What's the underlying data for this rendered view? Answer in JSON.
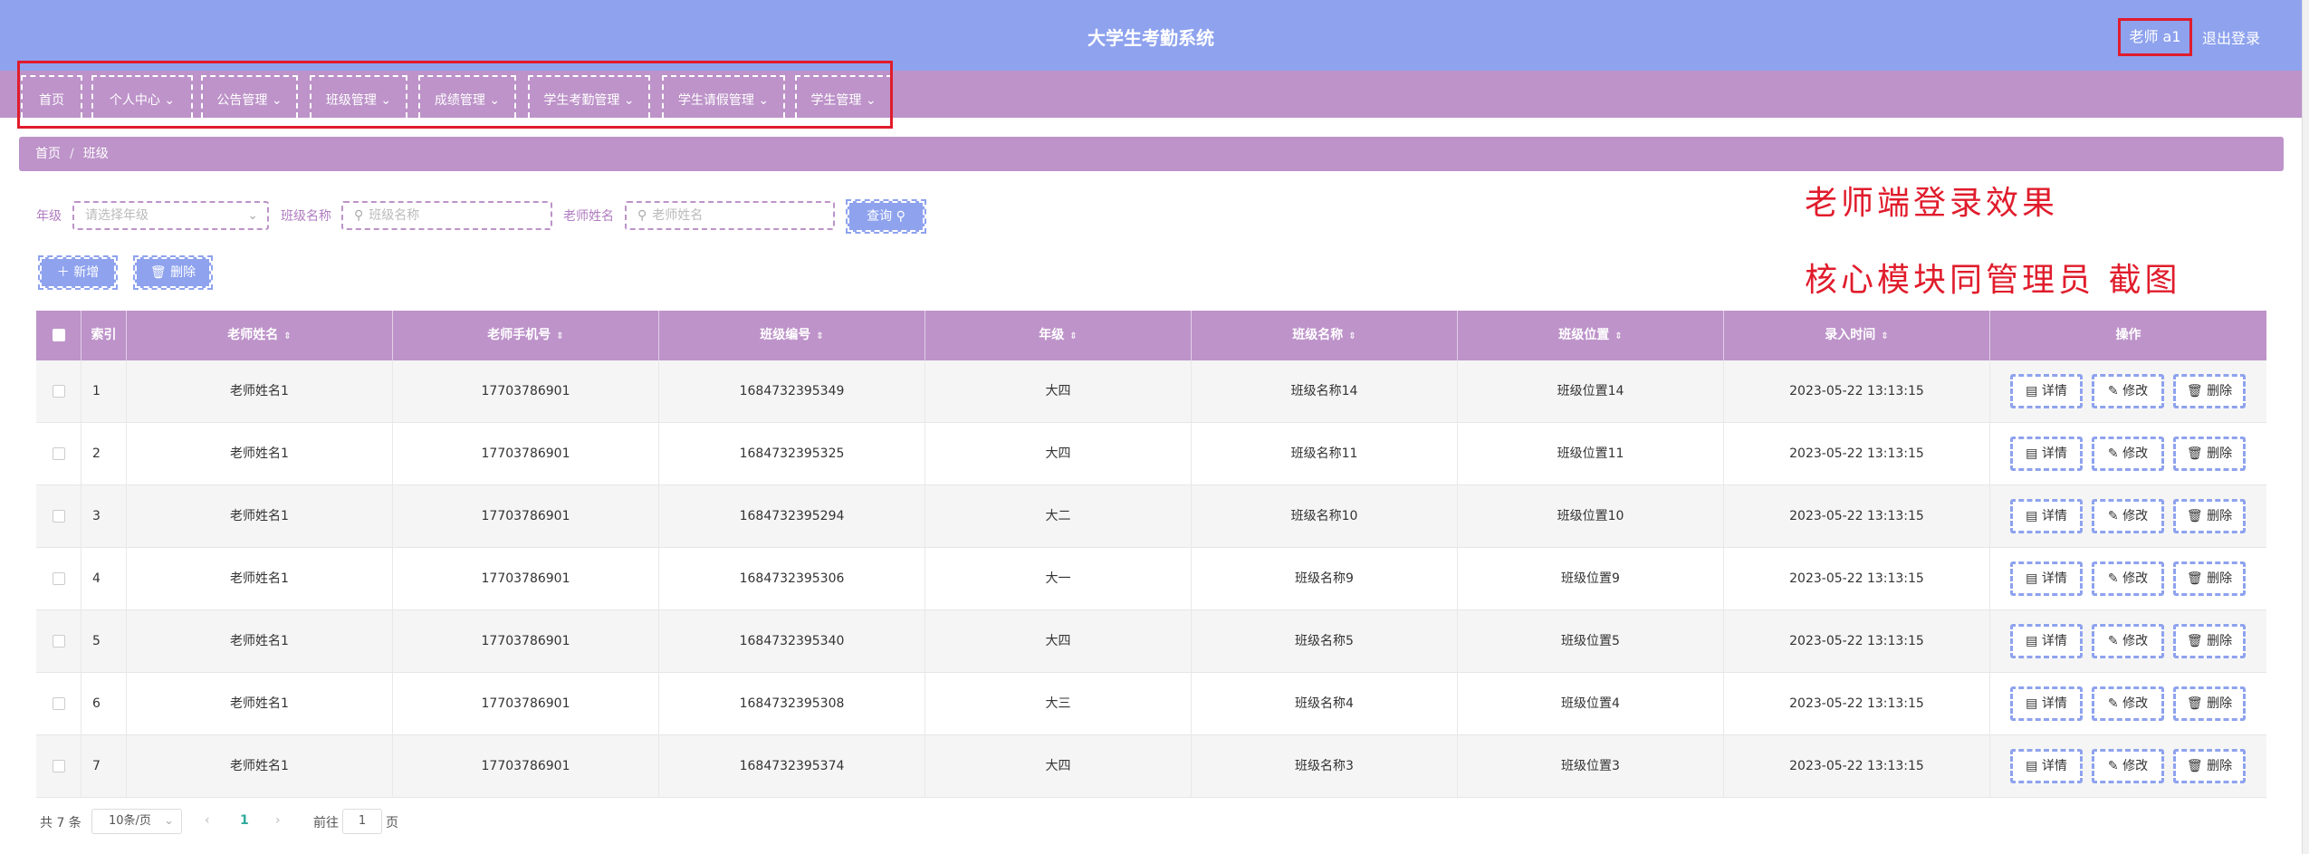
{
  "header": {
    "title": "大学生考勤系统",
    "user": "老师 a1",
    "logout": "退出登录"
  },
  "nav": [
    "首页",
    "个人中心",
    "公告管理",
    "班级管理",
    "成绩管理",
    "学生考勤管理",
    "学生请假管理",
    "学生管理"
  ],
  "breadcrumb": {
    "home": "首页",
    "current": "班级"
  },
  "search": {
    "grade_label": "年级",
    "grade_placeholder": "请选择年级",
    "class_label": "班级名称",
    "class_placeholder": "班级名称",
    "teacher_label": "老师姓名",
    "teacher_placeholder": "老师姓名",
    "query": "查询"
  },
  "actions": {
    "add": "新增",
    "delete": "删除"
  },
  "annotations": {
    "line1": "老师端登录效果",
    "line2": "核心模块同管理员  截图"
  },
  "table": {
    "columns": [
      "索引",
      "老师姓名",
      "老师手机号",
      "班级编号",
      "年级",
      "班级名称",
      "班级位置",
      "录入时间",
      "操作"
    ],
    "row_actions": {
      "detail": "详情",
      "edit": "修改",
      "delete": "删除"
    },
    "rows": [
      {
        "idx": "1",
        "teacher": "老师姓名1",
        "phone": "17703786901",
        "class_no": "1684732395349",
        "grade": "大四",
        "class_name": "班级名称14",
        "location": "班级位置14",
        "time": "2023-05-22 13:13:15"
      },
      {
        "idx": "2",
        "teacher": "老师姓名1",
        "phone": "17703786901",
        "class_no": "1684732395325",
        "grade": "大四",
        "class_name": "班级名称11",
        "location": "班级位置11",
        "time": "2023-05-22 13:13:15"
      },
      {
        "idx": "3",
        "teacher": "老师姓名1",
        "phone": "17703786901",
        "class_no": "1684732395294",
        "grade": "大二",
        "class_name": "班级名称10",
        "location": "班级位置10",
        "time": "2023-05-22 13:13:15"
      },
      {
        "idx": "4",
        "teacher": "老师姓名1",
        "phone": "17703786901",
        "class_no": "1684732395306",
        "grade": "大一",
        "class_name": "班级名称9",
        "location": "班级位置9",
        "time": "2023-05-22 13:13:15"
      },
      {
        "idx": "5",
        "teacher": "老师姓名1",
        "phone": "17703786901",
        "class_no": "1684732395340",
        "grade": "大四",
        "class_name": "班级名称5",
        "location": "班级位置5",
        "time": "2023-05-22 13:13:15"
      },
      {
        "idx": "6",
        "teacher": "老师姓名1",
        "phone": "17703786901",
        "class_no": "1684732395308",
        "grade": "大三",
        "class_name": "班级名称4",
        "location": "班级位置4",
        "time": "2023-05-22 13:13:15"
      },
      {
        "idx": "7",
        "teacher": "老师姓名1",
        "phone": "17703786901",
        "class_no": "1684732395374",
        "grade": "大四",
        "class_name": "班级名称3",
        "location": "班级位置3",
        "time": "2023-05-22 13:13:15"
      }
    ]
  },
  "pagination": {
    "total": "共 7 条",
    "page_size": "10条/页",
    "current": "1",
    "goto_prefix": "前往",
    "goto_value": "1",
    "goto_suffix": "页"
  },
  "colors": {
    "header": "#8ea2ee",
    "nav": "#bd93c9",
    "annotation": "#e01c2c"
  }
}
